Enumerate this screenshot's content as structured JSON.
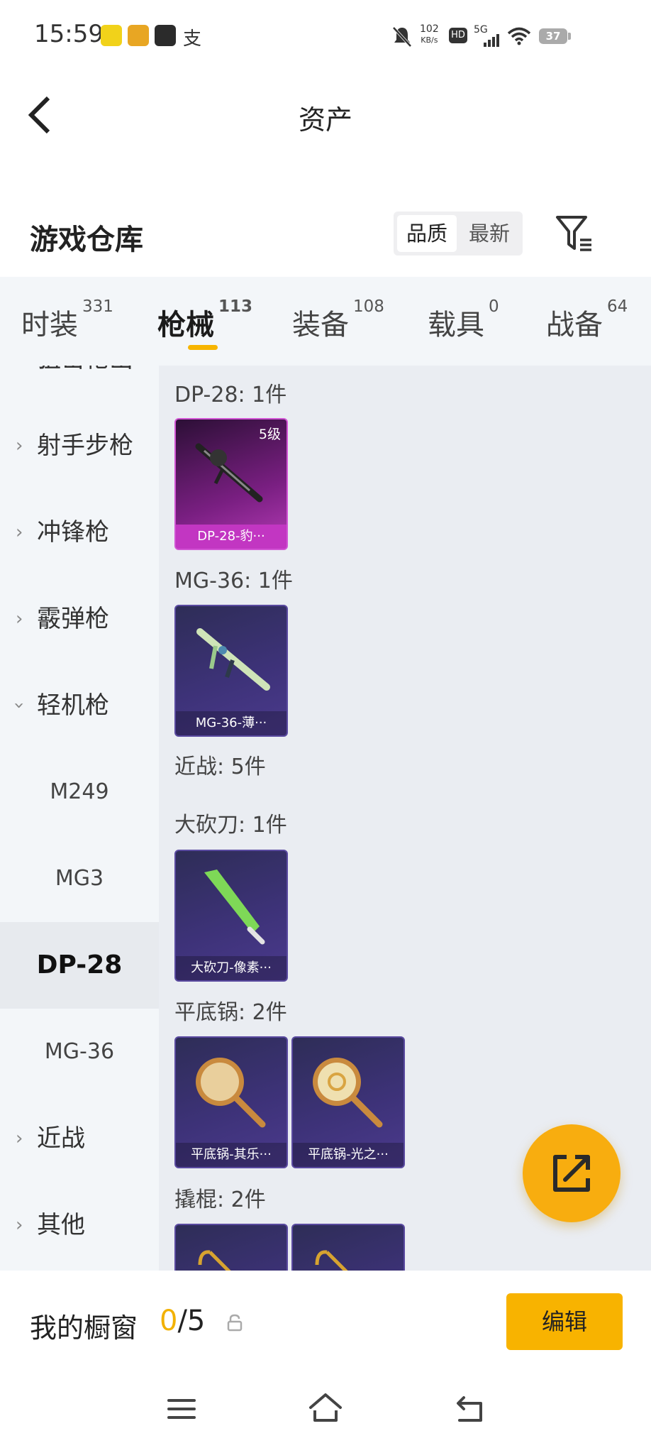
{
  "status_bar": {
    "time": "15:59",
    "net_speed_value": "102",
    "net_speed_unit": "KB/s",
    "hd": "HD",
    "network": "5G",
    "battery": "37"
  },
  "header": {
    "title": "资产"
  },
  "warehouse": {
    "title": "游戏仓库",
    "sort_options": [
      "品质",
      "最新"
    ],
    "sort_selected": "品质"
  },
  "tabs": [
    {
      "label": "时装",
      "count": "331"
    },
    {
      "label": "枪械",
      "count": "113"
    },
    {
      "label": "装备",
      "count": "108"
    },
    {
      "label": "载具",
      "count": "0"
    },
    {
      "label": "战备",
      "count": "64"
    }
  ],
  "active_tab": "枪械",
  "sidebar": {
    "partial_top": "狙击枪出",
    "items": [
      {
        "label": "射手步枪",
        "expanded": false
      },
      {
        "label": "冲锋枪",
        "expanded": false
      },
      {
        "label": "霰弹枪",
        "expanded": false
      },
      {
        "label": "轻机枪",
        "expanded": true
      }
    ],
    "subitems": [
      "M249",
      "MG3",
      "DP-28",
      "MG-36"
    ],
    "selected": "DP-28",
    "items_after": [
      {
        "label": "近战",
        "expanded": false
      },
      {
        "label": "其他",
        "expanded": false
      }
    ]
  },
  "content": {
    "groups": [
      {
        "title": "DP-28: 1件",
        "cards": [
          {
            "caption": "DP-28-豹···",
            "level": "5级",
            "rarity": "pink"
          }
        ]
      },
      {
        "title": "MG-36: 1件",
        "cards": [
          {
            "caption": "MG-36-薄···",
            "rarity": "purple"
          }
        ]
      },
      {
        "title": "近战: 5件",
        "cards": []
      },
      {
        "title": "大砍刀: 1件",
        "cards": [
          {
            "caption": "大砍刀-像素···",
            "rarity": "purple"
          }
        ]
      },
      {
        "title": "平底锅: 2件",
        "cards": [
          {
            "caption": "平底锅-其乐···",
            "rarity": "purple"
          },
          {
            "caption": "平底锅-光之···",
            "rarity": "purple"
          }
        ]
      },
      {
        "title": "撬棍: 2件",
        "cards": [
          {
            "caption": "",
            "rarity": "purple"
          },
          {
            "caption": "",
            "rarity": "purple"
          }
        ]
      }
    ]
  },
  "showcase": {
    "title": "我的橱窗",
    "current": "0",
    "total": "/5",
    "edit_label": "编辑"
  },
  "colors": {
    "accent": "#f8b300",
    "tab_bg": "#f3f6f9",
    "content_bg": "#eaedf2",
    "card_purple": "#3d3278",
    "card_pink": "#b53bb6"
  }
}
